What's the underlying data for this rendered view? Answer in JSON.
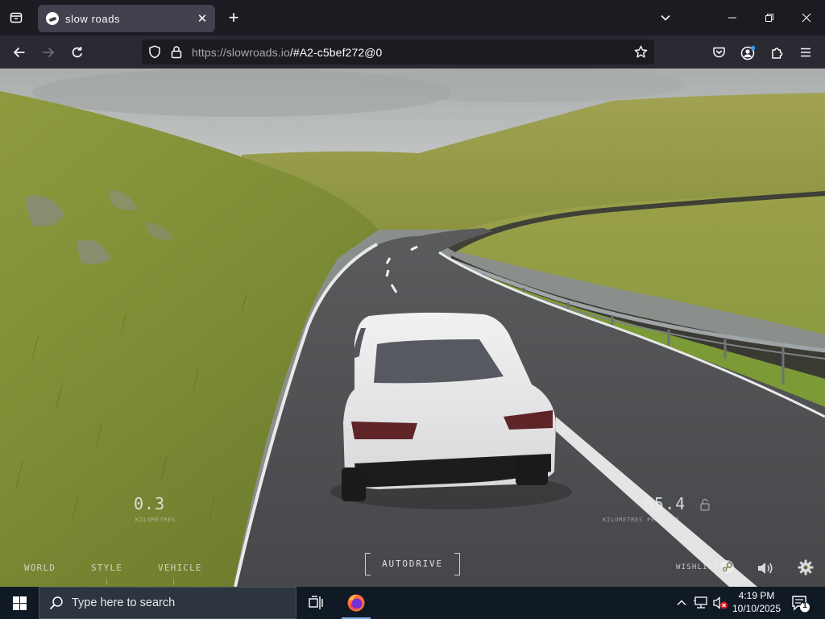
{
  "browser": {
    "tab_title": "slow roads",
    "url_host": "https://slowroads.io",
    "url_path": "/#A2-c5bef272@0"
  },
  "hud": {
    "speed_value": "0.3",
    "speed_unit": "KILOMETRES",
    "distance_value": "65.4",
    "distance_unit": "KILOMETRES PER HOUR",
    "menu": [
      "WORLD",
      "STYLE",
      "VEHICLE"
    ],
    "autodrive_label": "AUTODRIVE",
    "wishlist_label": "WISHLIST"
  },
  "taskbar": {
    "search_placeholder": "Type here to search",
    "time": "4:19 PM",
    "date": "10/10/2025",
    "notification_count": "1"
  },
  "colors": {
    "sky": "#b6b9b8",
    "grass": "#8a9a3c",
    "road": "#4b4c4e",
    "car": "#e9e9ea",
    "taskbar": "#0f1a24"
  }
}
